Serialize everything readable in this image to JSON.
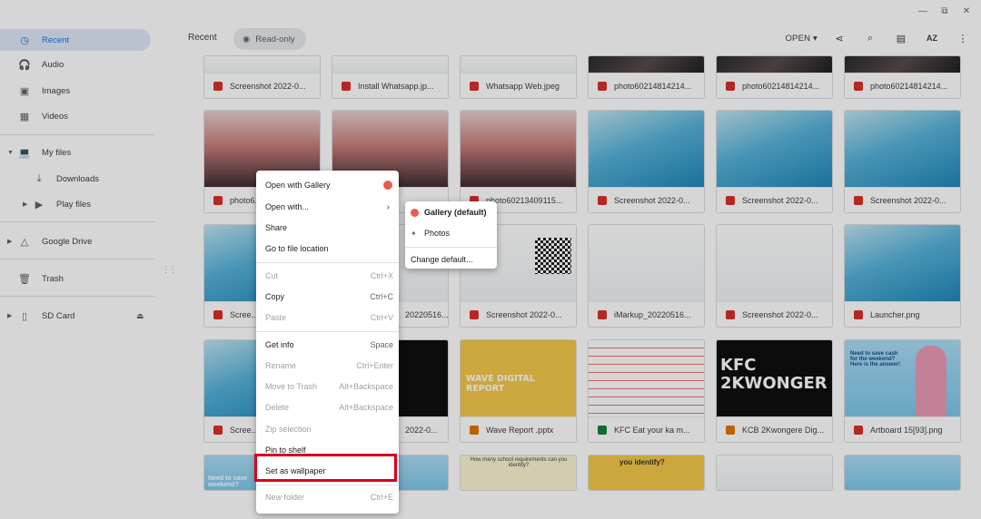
{
  "window": {
    "minimize": "—",
    "restore": "⧉",
    "close": "✕"
  },
  "sidebar": {
    "items": [
      {
        "label": "Recent",
        "icon": "clock-icon",
        "glyph": "◷"
      },
      {
        "label": "Audio",
        "icon": "headphones-icon",
        "glyph": "🎧"
      },
      {
        "label": "Images",
        "icon": "image-icon",
        "glyph": "▣"
      },
      {
        "label": "Videos",
        "icon": "video-icon",
        "glyph": "▦"
      },
      {
        "label": "My files",
        "icon": "computer-icon",
        "glyph": "💻"
      },
      {
        "label": "Downloads",
        "icon": "download-icon",
        "glyph": "⤓"
      },
      {
        "label": "Play files",
        "icon": "play-icon",
        "glyph": "▶"
      },
      {
        "label": "Google Drive",
        "icon": "drive-icon",
        "glyph": "△"
      },
      {
        "label": "Trash",
        "icon": "trash-icon",
        "glyph": "🗑"
      },
      {
        "label": "SD Card",
        "icon": "sd-card-icon",
        "glyph": "▯"
      }
    ],
    "eject": "⏏"
  },
  "header": {
    "breadcrumb": "Recent",
    "readonly": "Read-only",
    "open_label": "OPEN"
  },
  "files": [
    [
      "Screenshot 2022-0...",
      "Install Whatsapp.jp...",
      "Whatsapp Web.jpeg",
      "photo60214814214...",
      "photo60214814214...",
      "photo60214814214..."
    ],
    [
      "photo6...",
      "",
      "photo60213409115...",
      "Screenshot 2022-0...",
      "Screenshot 2022-0...",
      "Screenshot 2022-0..."
    ],
    [
      "Scree...",
      "",
      "Screenshot 2022-0...",
      "iMarkup_20220516...",
      "Screenshot 2022-0...",
      "Launcher.png"
    ],
    [
      "Scree...",
      "2022-0...",
      "Wave Report .pptx",
      "KFC Eat your ka m...",
      "KCB 2Kwongere Dig...",
      "Artboard 15[93].png"
    ]
  ],
  "partial_names": {
    "row3_col2": "20220516...",
    "row4_col2": "2022-0..."
  },
  "thumb_text": {
    "wave": "WAVE DIGITAL REPORT",
    "kfc_line1": "KFC",
    "kfc_line2": "2KWONGER",
    "artboard": "Need to save cash for the weekend? Here is the answer!",
    "row5_b": "you identify?",
    "row5_a": "How many school requirements can you identify?",
    "need_save": "Need to save weekend?"
  },
  "context_menu": {
    "items": [
      {
        "label": "Open with Gallery",
        "shortcut": "",
        "disabled": false
      },
      {
        "label": "Open with...",
        "shortcut": "",
        "disabled": false
      },
      {
        "label": "Share",
        "shortcut": "",
        "disabled": false
      },
      {
        "label": "Go to file location",
        "shortcut": "",
        "disabled": false
      },
      {
        "label": "Cut",
        "shortcut": "Ctrl+X",
        "disabled": true
      },
      {
        "label": "Copy",
        "shortcut": "Ctrl+C",
        "disabled": false
      },
      {
        "label": "Paste",
        "shortcut": "Ctrl+V",
        "disabled": true
      },
      {
        "label": "Get info",
        "shortcut": "Space",
        "disabled": false
      },
      {
        "label": "Rename",
        "shortcut": "Ctrl+Enter",
        "disabled": true
      },
      {
        "label": "Move to Trash",
        "shortcut": "Alt+Backspace",
        "disabled": true
      },
      {
        "label": "Delete",
        "shortcut": "Alt+Backspace",
        "disabled": true
      },
      {
        "label": "Zip selection",
        "shortcut": "",
        "disabled": true
      },
      {
        "label": "Pin to shelf",
        "shortcut": "",
        "disabled": false
      },
      {
        "label": "Set as wallpaper",
        "shortcut": "",
        "disabled": false
      },
      {
        "label": "New folder",
        "shortcut": "Ctrl+E",
        "disabled": true
      }
    ]
  },
  "submenu": {
    "items": [
      {
        "label": "Gallery (default)"
      },
      {
        "label": "Photos"
      },
      {
        "label": "Change default..."
      }
    ]
  },
  "colors": {
    "accent": "#1a73e8",
    "highlight_box": "#d9001b"
  }
}
